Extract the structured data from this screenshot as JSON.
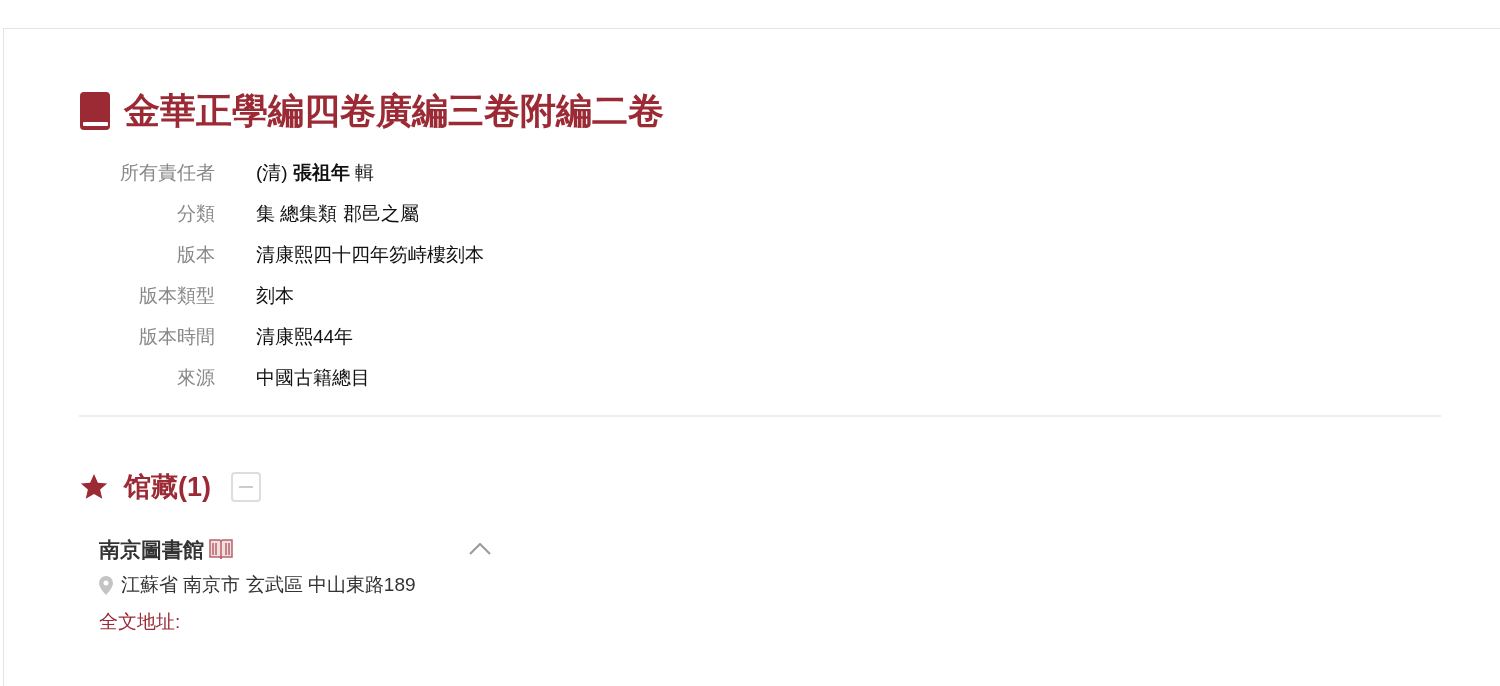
{
  "title": "金華正學編四卷廣編三卷附編二卷",
  "fields": [
    {
      "label": "所有責任者",
      "value": "(清) **張祖年**  輯"
    },
    {
      "label": "分類",
      "value": "集 總集類 郡邑之屬"
    },
    {
      "label": "版本",
      "value": "清康熙四十四年笏峙樓刻本"
    },
    {
      "label": "版本類型",
      "value": "刻本"
    },
    {
      "label": "版本時間",
      "value": "清康熙44年"
    },
    {
      "label": "來源",
      "value": "中國古籍總目"
    }
  ],
  "holdings": {
    "heading": "馆藏(1)",
    "expanded": true,
    "libraries": [
      {
        "name": "南京圖書館",
        "expanded": true,
        "address": "江蘇省 南京市 玄武區 中山東路189",
        "link": "全文地址:"
      }
    ]
  }
}
